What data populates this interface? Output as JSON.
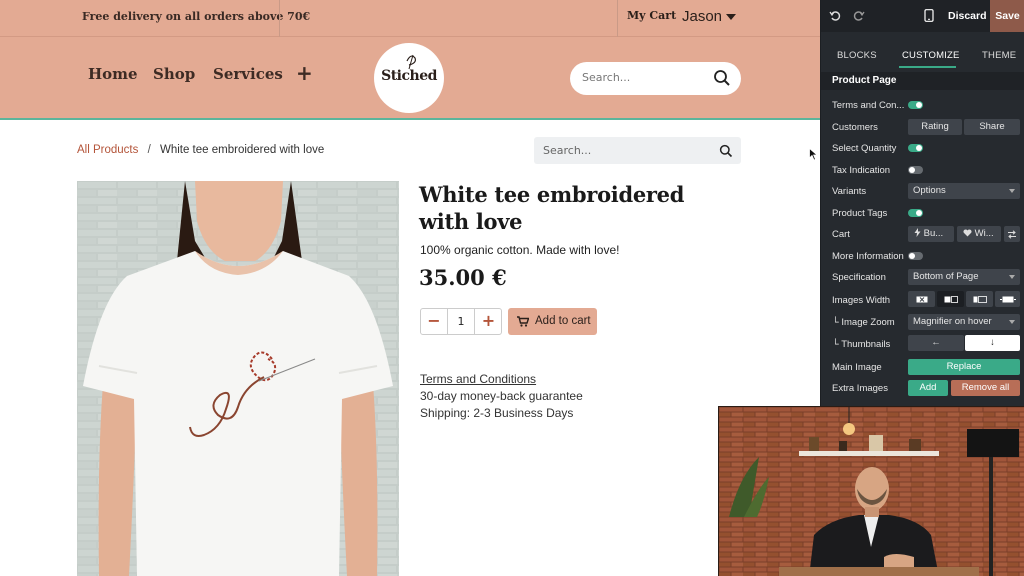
{
  "site": {
    "promo_text": "Free delivery on all orders above 70€",
    "my_cart": "My Cart",
    "user_name": "Jason",
    "nav": {
      "home": "Home",
      "shop": "Shop",
      "services": "Services",
      "plus": "+"
    },
    "logo_text": "Stiched",
    "search_placeholder": "Search...",
    "breadcrumb": {
      "all_products": "All Products",
      "separator": "/",
      "current": "White tee embroidered with love"
    },
    "page_search_placeholder": "Search...",
    "product": {
      "title": "White tee embroidered with love",
      "description": "100% organic cotton. Made with love!",
      "price": "35.00 €",
      "quantity": "1",
      "minus": "−",
      "plus": "+",
      "add_to_cart": "Add to cart",
      "terms": "Terms and Conditions",
      "guarantee": "30-day money-back guarantee",
      "shipping": "Shipping: 2-3 Business Days"
    },
    "colors": {
      "header_bg": "#e3aa93",
      "accent_link": "#b4553a",
      "divider": "#5bb59b"
    }
  },
  "editor": {
    "discard": "Discard",
    "save": "Save",
    "tabs": [
      "BLOCKS",
      "CUSTOMIZE",
      "THEME"
    ],
    "active_tab": "CUSTOMIZE",
    "section_title": "Product Page",
    "rows": {
      "terms": {
        "label": "Terms and Con...",
        "toggle": "on"
      },
      "customers": {
        "label": "Customers",
        "btn1": "Rating",
        "btn2": "Share"
      },
      "select_quantity": {
        "label": "Select Quantity",
        "toggle": "on"
      },
      "tax_indication": {
        "label": "Tax Indication",
        "toggle": "off"
      },
      "variants": {
        "label": "Variants",
        "select": "Options"
      },
      "product_tags": {
        "label": "Product Tags",
        "toggle": "on"
      },
      "cart": {
        "label": "Cart",
        "btn1": "Bu...",
        "btn2": "Wi..."
      },
      "more_information": {
        "label": "More Information",
        "toggle": "off"
      },
      "specification": {
        "label": "Specification",
        "select": "Bottom of Page"
      },
      "images_width": {
        "label": "Images Width"
      },
      "image_zoom": {
        "label": "└ Image Zoom",
        "select": "Magnifier on hover"
      },
      "thumbnails": {
        "label": "└ Thumbnails",
        "opt1": "←",
        "opt2": "↓"
      },
      "main_image": {
        "label": "Main Image",
        "btn": "Replace"
      },
      "extra_images": {
        "label": "Extra Images",
        "add": "Add",
        "remove": "Remove all"
      }
    },
    "colors": {
      "panel_bg": "#262a2f",
      "accent": "#3aaa88",
      "danger": "#b86e57",
      "save_bg": "#8e5a4a"
    }
  }
}
